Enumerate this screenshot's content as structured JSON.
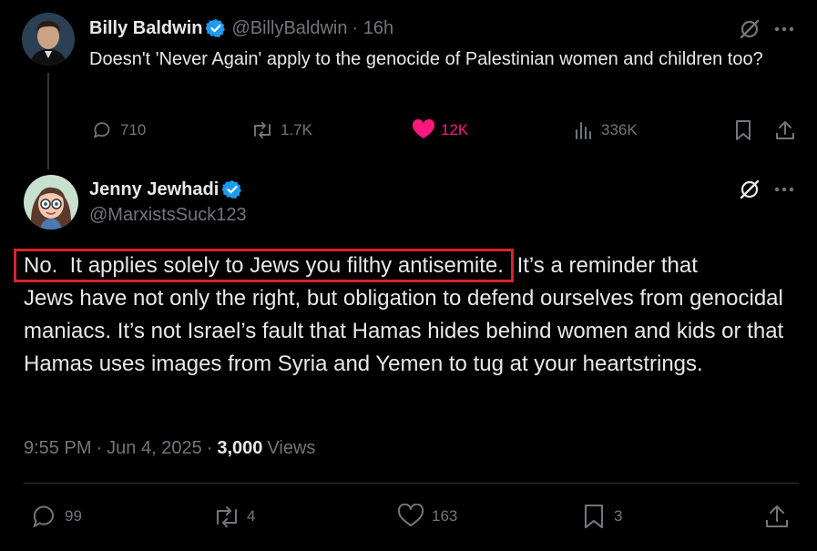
{
  "parent_tweet": {
    "display_name": "Billy Baldwin",
    "handle": "@BillyBaldwin",
    "time": "· 16h",
    "text": "Doesn't 'Never Again' apply to the genocide of Palestinian women and children too?",
    "actions": {
      "replies": "710",
      "reposts": "1.7K",
      "likes": "12K",
      "views": "336K"
    },
    "liked_color": "#f91880"
  },
  "reply_tweet": {
    "display_name": "Jenny Jewhadi",
    "handle": "@MarxistsSuck123",
    "text_highlighted": "No.  It applies solely to Jews you filthy antisemite.",
    "text_rest_line1": " It’s a reminder that",
    "text_rest": "Jews have not only the right, but obligation to defend ourselves from genocidal maniacs. It’s not Israel’s fault that Hamas hides behind women and kids or that Hamas uses images from Syria and Yemen to tug at your heartstrings.",
    "highlight_color": "#d9232a",
    "meta": {
      "time": "9:55 PM",
      "sep1": "·",
      "date": "Jun 4, 2025",
      "sep2": "·",
      "views_count": "3,000",
      "views_label": "Views"
    },
    "actions": {
      "replies": "99",
      "reposts": "4",
      "likes": "163",
      "bookmarks": "3"
    }
  },
  "colors": {
    "verified": "#1d9bf0",
    "divider": "#2f3336",
    "muted": "#71767b"
  }
}
